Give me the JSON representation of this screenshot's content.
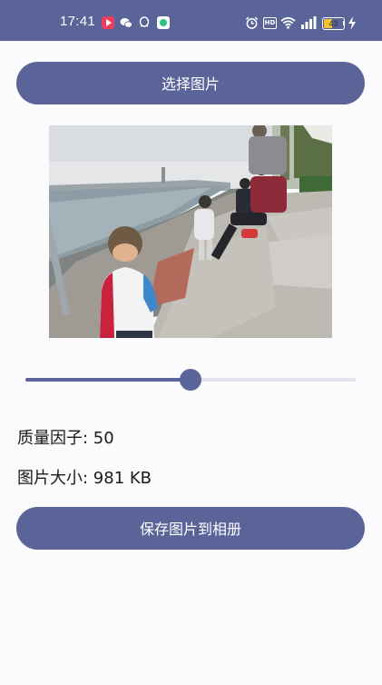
{
  "status_bar": {
    "time": "17:41",
    "battery_level": "43",
    "battery_percent": 43,
    "background_color": "#5b6499",
    "notification_icons": [
      "video-app-icon",
      "wechat-icon",
      "qq-icon",
      "green-app-icon"
    ],
    "system_icons": [
      "alarm-icon",
      "hd-icon",
      "wifi-icon",
      "signal-icon",
      "battery-icon",
      "charging-icon"
    ],
    "hd_label": "HD"
  },
  "actions": {
    "select_image_label": "选择图片",
    "save_image_label": "保存图片到相册"
  },
  "image": {
    "description": "selected photo preview"
  },
  "slider": {
    "value": 50,
    "min": 0,
    "max": 100
  },
  "info": {
    "quality_text": "质量因子: 50",
    "size_text": "图片大小: 981 KB"
  },
  "colors": {
    "primary": "#5b6499",
    "track_inactive": "#e3e3f0",
    "background": "#fbfbfd"
  }
}
